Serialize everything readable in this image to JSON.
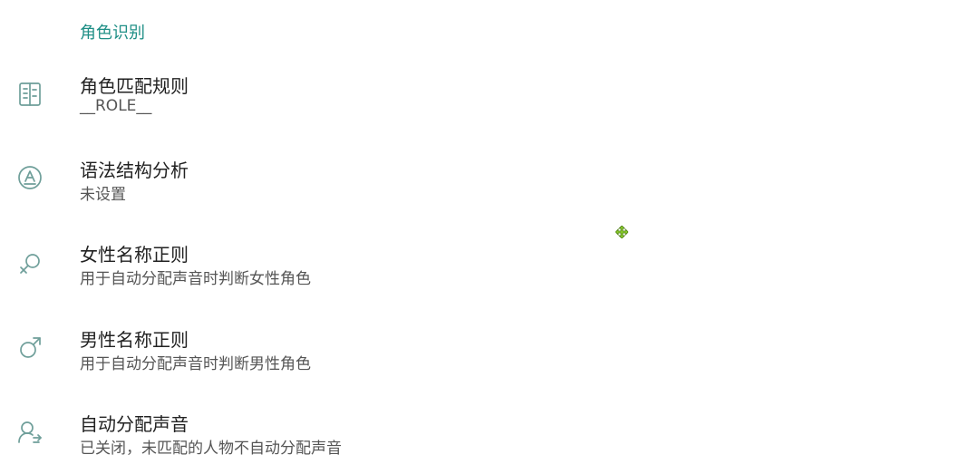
{
  "section": {
    "title": "角色识别",
    "accent_color": "#1f8f86"
  },
  "items": [
    {
      "icon": "rules-list-icon",
      "title": "角色匹配规则",
      "summary": "__ROLE__"
    },
    {
      "icon": "grammar-circle-a-icon",
      "title": "语法结构分析",
      "summary": "未设置"
    },
    {
      "icon": "female-symbol-icon",
      "title": "女性名称正则",
      "summary": "用于自动分配声音时判断女性角色"
    },
    {
      "icon": "male-symbol-icon",
      "title": "男性名称正则",
      "summary": "用于自动分配声音时判断男性角色"
    },
    {
      "icon": "person-voice-icon",
      "title": "自动分配声音",
      "summary": "已关闭，未匹配的人物不自动分配声音"
    }
  ],
  "icon_color": "#6f9f9a",
  "cursor_icon": "move-cursor-icon"
}
